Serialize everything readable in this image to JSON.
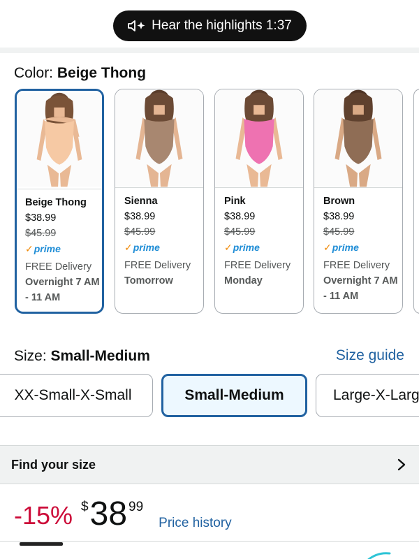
{
  "header": {
    "highlights_label": "Hear the highlights 1:37"
  },
  "color": {
    "label": "Color: ",
    "selected": "Beige Thong",
    "swatches": [
      {
        "name": "Beige Thong",
        "price": "$38.99",
        "old_price": "$45.99",
        "prime": "prime",
        "delivery": "FREE Delivery",
        "when": "Overnight 7 AM - 11 AM",
        "color": "#f6c9a4"
      },
      {
        "name": "Sienna",
        "price": "$38.99",
        "old_price": "$45.99",
        "prime": "prime",
        "delivery": "FREE Delivery",
        "when": "Tomorrow",
        "color": "#a88770"
      },
      {
        "name": "Pink",
        "price": "$38.99",
        "old_price": "$45.99",
        "prime": "prime",
        "delivery": "FREE Delivery",
        "when": "Monday",
        "color": "#ee72b1"
      },
      {
        "name": "Brown",
        "price": "$38.99",
        "old_price": "$45.99",
        "prime": "prime",
        "delivery": "FREE Delivery",
        "when": "Overnight 7 AM - 11 AM",
        "color": "#8f6d55"
      }
    ]
  },
  "size": {
    "label": "Size: ",
    "selected": "Small-Medium",
    "guide_label": "Size guide",
    "options": [
      "XX-Small-X-Small",
      "Small-Medium",
      "Large-X-Large"
    ]
  },
  "find_size": {
    "label": "Find your size"
  },
  "price": {
    "discount": "-15%",
    "currency": "$",
    "whole": "38",
    "fraction": "99",
    "history_label": "Price history"
  },
  "colors": {
    "link": "#2162a1",
    "selected_border": "#2162a1",
    "discount": "#cc0c39",
    "prime_blue": "#1f8dd6",
    "prime_check": "#f08804"
  }
}
